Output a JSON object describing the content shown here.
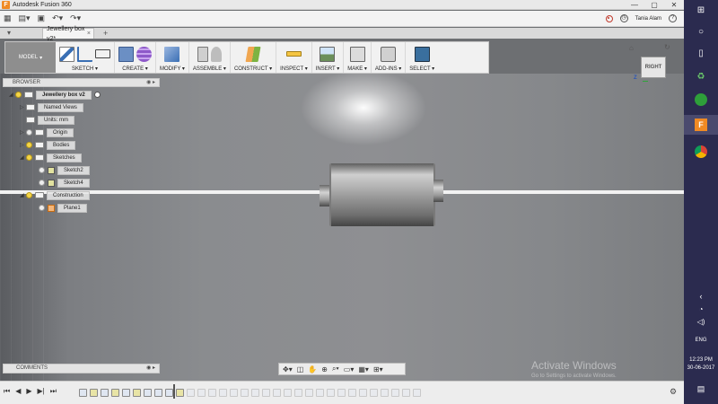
{
  "window": {
    "title": "Autodesk Fusion 360",
    "controls": [
      "—",
      "▢",
      "✕"
    ]
  },
  "qabar": {
    "user_name": "Tania Alam",
    "icons": [
      "grid-icon",
      "file-icon",
      "save-icon",
      "undo-icon",
      "redo-icon"
    ]
  },
  "tabs": [
    {
      "label": "Jewellery box v2*"
    }
  ],
  "ribbon": {
    "mode_label": "MODEL",
    "groups": [
      {
        "label": "SKETCH ▾"
      },
      {
        "label": "CREATE ▾"
      },
      {
        "label": "MODIFY ▾"
      },
      {
        "label": "ASSEMBLE ▾"
      },
      {
        "label": "CONSTRUCT ▾"
      },
      {
        "label": "INSPECT ▾"
      },
      {
        "label": "INSERT ▾"
      },
      {
        "label": "MAKE ▾"
      },
      {
        "label": "ADD-INS ▾"
      },
      {
        "label": "SELECT ▾"
      }
    ]
  },
  "browser": {
    "header": "BROWSER",
    "root": "Jewellery box v2",
    "items": [
      {
        "label": "Named Views"
      },
      {
        "label": "Units: mm"
      },
      {
        "label": "Origin"
      },
      {
        "label": "Bodies"
      },
      {
        "label": "Sketches"
      },
      {
        "label": "Sketch2"
      },
      {
        "label": "Sketch4"
      },
      {
        "label": "Construction"
      },
      {
        "label": "Plane1"
      }
    ]
  },
  "comments": {
    "header": "COMMENTS"
  },
  "viewcube": {
    "face_label": "RIGHT",
    "axis_z": "Z"
  },
  "watermark": {
    "title": "Activate Windows",
    "subtitle": "Go to Settings to activate Windows."
  },
  "taskbar": {
    "language": "ENG",
    "time": "12:23 PM",
    "date": "30-06-2017"
  },
  "colors": {
    "ribbon_bg": "#f1f1f1",
    "model_btn": "#8e8e8e",
    "taskbar": "#2b2b4f",
    "accent_orange": "#f08a24"
  }
}
